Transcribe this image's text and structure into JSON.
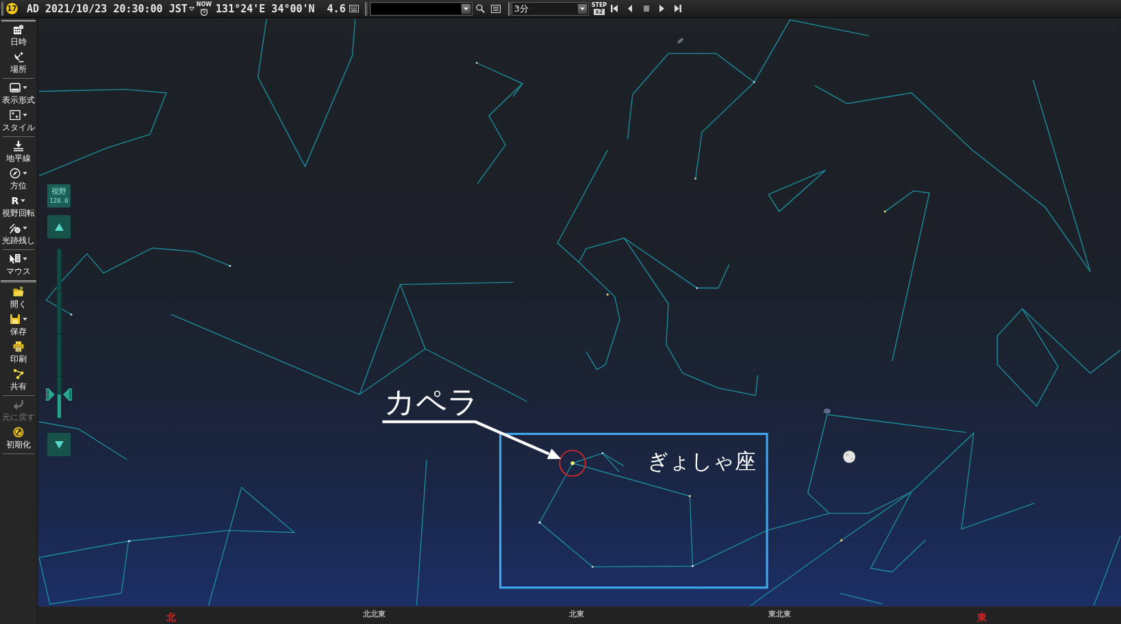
{
  "toolbar": {
    "logo": "17",
    "era": "AD",
    "datetime": "2021/10/23 20:30:00",
    "timezone": "JST",
    "now": "NOW",
    "location": "131°24'E 34°00'N",
    "magnitude": "4.6",
    "step_interval": "3分",
    "step_label": "STEP",
    "step_multiplier": "x2"
  },
  "sidebar": {
    "groups": [
      [
        {
          "label": "日時",
          "menu": false,
          "disabled": false
        },
        {
          "label": "場所",
          "menu": false,
          "disabled": false
        }
      ],
      [
        {
          "label": "表示形式",
          "menu": true,
          "disabled": false
        },
        {
          "label": "スタイル",
          "menu": true,
          "disabled": false
        }
      ],
      [
        {
          "label": "地平線",
          "menu": false,
          "disabled": false
        },
        {
          "label": "方位",
          "menu": true,
          "disabled": false
        },
        {
          "label": "視野回転",
          "menu": true,
          "disabled": false,
          "glyph": "R"
        },
        {
          "label": "光跡残し",
          "menu": true,
          "disabled": false
        }
      ],
      [
        {
          "label": "マウス",
          "menu": true,
          "disabled": false
        }
      ],
      [
        {
          "label": "開く",
          "menu": false,
          "disabled": false
        },
        {
          "label": "保存",
          "menu": true,
          "disabled": false
        },
        {
          "label": "印刷",
          "menu": false,
          "disabled": false
        },
        {
          "label": "共有",
          "menu": false,
          "disabled": false
        }
      ],
      [
        {
          "label": "元に戻す",
          "menu": false,
          "disabled": true
        },
        {
          "label": "初期化",
          "menu": false,
          "disabled": false
        }
      ]
    ]
  },
  "fov": {
    "label": "視野",
    "value": "120.0",
    "level": 0.14
  },
  "sky": {
    "star_label": "カペラ",
    "constellation_label": "ぎょしゃ座"
  },
  "directions": [
    {
      "label": "北",
      "cardinal": true
    },
    {
      "label": "北北東",
      "cardinal": false
    },
    {
      "label": "北東",
      "cardinal": false
    },
    {
      "label": "東北東",
      "cardinal": false
    },
    {
      "label": "東",
      "cardinal": true
    }
  ]
}
